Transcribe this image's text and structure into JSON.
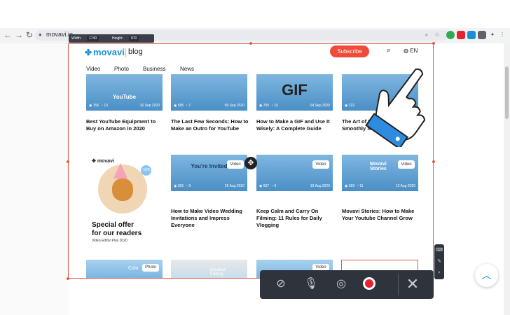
{
  "browser": {
    "url": "movavi.io",
    "extensions": [
      "search-zoom",
      "bookmark-star",
      "extension-green",
      "extension-red",
      "extension-blue",
      "extension-gray",
      "puzzle",
      "profile",
      "menu"
    ]
  },
  "capture_size": {
    "width_label": "Width:",
    "width_value": "1740",
    "height_label": "Height:",
    "height_value": "870"
  },
  "site": {
    "logo": "movavi",
    "section": "blog",
    "subscribe": "Subscribe",
    "language": "EN",
    "nav": [
      "Video",
      "Photo",
      "Business",
      "News"
    ]
  },
  "cards_row1": [
    {
      "views": "156",
      "comments": "13",
      "date": "16 Sep 2020",
      "title": "Best YouTube Equipment to Buy on Amazon in 2020",
      "art": "YouTube"
    },
    {
      "views": "585",
      "comments": "7",
      "date": "09 Sep 2020",
      "title": "The Last Few Seconds: How to Make an Outro for YouTube",
      "art": ""
    },
    {
      "views": "705",
      "comments": "15",
      "date": "04 Sep 2020",
      "title": "How to Make a GIF and Use It Wisely: A Complete Guide",
      "art": "GIF"
    },
    {
      "views": "222",
      "comments": "",
      "date": "",
      "title": "The Art of Ramping: How to Smoothly Slow... Videos",
      "art": ""
    }
  ],
  "cards_row2": [
    {
      "views": "355",
      "comments": "9",
      "date": "26 Aug 2020",
      "tag": "Video",
      "title": "How to Make Video Wedding Invitations and Impress Everyone",
      "art": "You're Invited"
    },
    {
      "views": "667",
      "comments": "9",
      "date": "19 Aug 2020",
      "tag": "Video",
      "title": "Keep Calm and Carry On Filming: 11 Rules for Daily Vlogging",
      "art": ""
    },
    {
      "views": "589",
      "comments": "11",
      "date": "12 Aug 2020",
      "tag": "Video",
      "title": "Movavi Stories: How to Make Your Youtube Channel Grow",
      "art": "Movavi Stories"
    }
  ],
  "promo": {
    "logo": "movavi",
    "badge": "-10%",
    "headline_1": "Special offer",
    "headline_2": "for our readers",
    "sub": "Video Editor Plus 2020"
  },
  "cards_row3": [
    {
      "tag": "Photo",
      "art": "Colo"
    },
    {
      "tag": "",
      "art": "Creative Editing"
    },
    {
      "tag": "Video",
      "art": ""
    }
  ],
  "recorder": {
    "buttons": [
      "webcam-off",
      "mic-off",
      "system-audio-off",
      "record",
      "close"
    ]
  },
  "colors": {
    "accent": "#1b8fd6",
    "subscribe": "#ef4b3a",
    "capture_frame": "#e25c4b",
    "recorder_bg": "#2f333c",
    "record": "#e8212e"
  }
}
